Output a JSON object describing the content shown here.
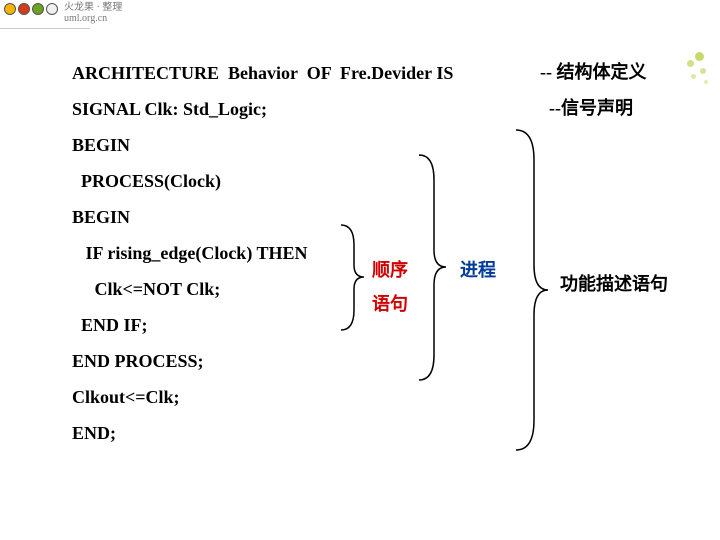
{
  "header": {
    "brand": "火龙果 · 整理",
    "url": "uml.org.cn"
  },
  "code": {
    "l1": "ARCHITECTURE  Behavior  OF  Fre.Devider IS",
    "l2": "SIGNAL Clk: Std_Logic;",
    "l3": "BEGIN",
    "l4": "  PROCESS(Clock)",
    "l5": "BEGIN",
    "l6": "   IF rising_edge(Clock) THEN",
    "l7": "     Clk<=NOT Clk;",
    "l8": "  END IF;",
    "l9": "END PROCESS;",
    "l10": "Clkout<=Clk;",
    "l11": "END;"
  },
  "annotations": {
    "arch_def": "-- 结构体定义",
    "signal_decl": "--信号声明",
    "seq": "顺序",
    "stmt": "语句",
    "process": "进程",
    "behavior_stmt": "功能描述语句"
  }
}
